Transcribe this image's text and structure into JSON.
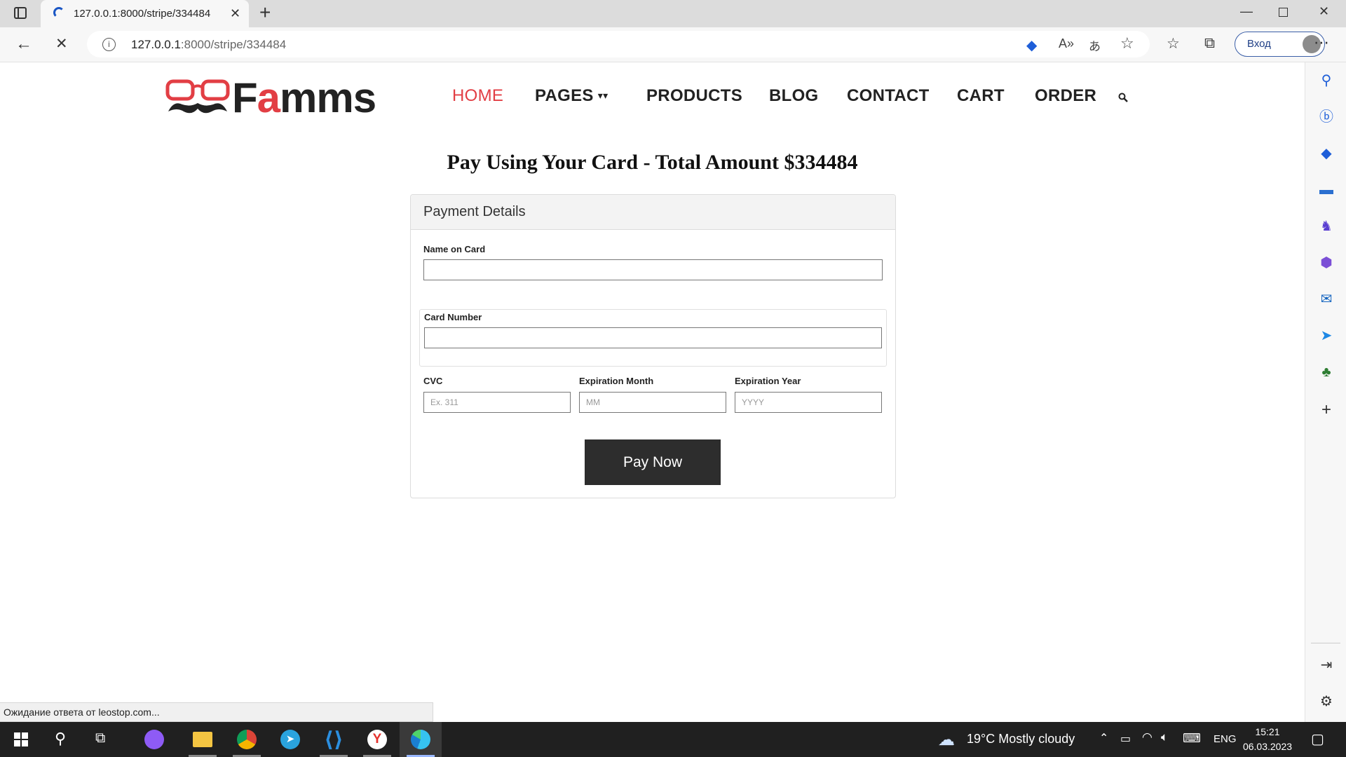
{
  "browser": {
    "tab_title": "127.0.0.1:8000/stripe/334484",
    "url_host": "127.0.0.1",
    "url_rest": ":8000/stripe/334484",
    "signin_label": "Вход",
    "status_text": "Ожидание ответа от leostop.com..."
  },
  "site": {
    "logo_prefix": "F",
    "logo_red": "a",
    "logo_suffix": "mms",
    "nav": {
      "home": "HOME",
      "pages": "PAGES",
      "products": "PRODUCTS",
      "blog": "BLOG",
      "contact": "CONTACT",
      "cart": "CART",
      "order": "ORDER"
    },
    "accent_color": "#e23e44"
  },
  "payment": {
    "title": "Pay Using Your Card - Total Amount $334484",
    "card_heading": "Payment Details",
    "name_label": "Name on Card",
    "name_value": "",
    "number_label": "Card Number",
    "number_value": "",
    "cvc_label": "CVC",
    "cvc_placeholder": "Ex. 311",
    "month_label": "Expiration Month",
    "month_placeholder": "MM",
    "year_label": "Expiration Year",
    "year_placeholder": "YYYY",
    "pay_button": "Pay Now"
  },
  "taskbar": {
    "weather": "19°C  Mostly cloudy",
    "language": "ENG",
    "time": "15:21",
    "date": "06.03.2023"
  }
}
